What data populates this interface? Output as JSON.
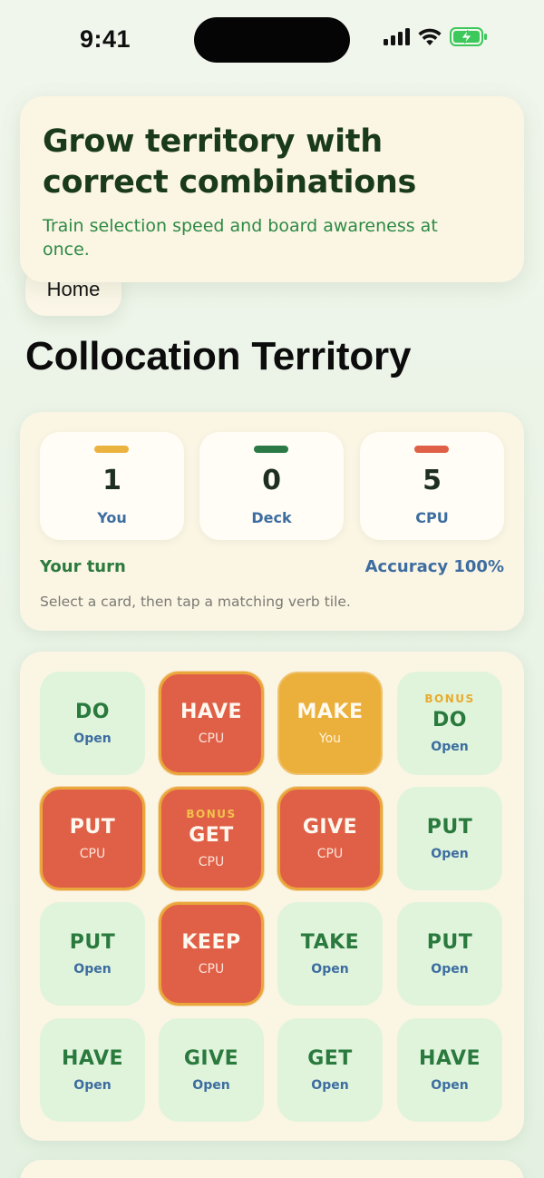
{
  "status_bar": {
    "time": "9:41",
    "icons": [
      "signal-icon",
      "wifi-icon",
      "battery-charging-icon"
    ],
    "battery_color": "#3cc85a"
  },
  "hero": {
    "title": "Grow territory with correct combinations",
    "subtitle": "Train selection speed and board awareness at once."
  },
  "nav": {
    "home_label": "Home"
  },
  "page": {
    "title": "Collocation Territory"
  },
  "scores": [
    {
      "value": "1",
      "label": "You",
      "bar_color": "#ebb240"
    },
    {
      "value": "0",
      "label": "Deck",
      "bar_color": "#2b7a45"
    },
    {
      "value": "5",
      "label": "CPU",
      "bar_color": "#e06047"
    }
  ],
  "status": {
    "turn": "Your turn",
    "accuracy": "Accuracy 100%",
    "hint": "Select a card, then tap a matching verb tile."
  },
  "colors": {
    "open_tile": "#e0f4dc",
    "cpu_tile": "#e06047",
    "you_tile": "#ebaf3c",
    "accent_green": "#2b7a3e",
    "accent_blue": "#3d6da0"
  },
  "board": {
    "tiles": [
      {
        "verb": "DO",
        "owner": "Open",
        "state": "open",
        "bonus": ""
      },
      {
        "verb": "HAVE",
        "owner": "CPU",
        "state": "cpu",
        "bonus": ""
      },
      {
        "verb": "MAKE",
        "owner": "You",
        "state": "you",
        "bonus": ""
      },
      {
        "verb": "DO",
        "owner": "Open",
        "state": "open",
        "bonus": "BONUS"
      },
      {
        "verb": "PUT",
        "owner": "CPU",
        "state": "cpu",
        "bonus": ""
      },
      {
        "verb": "GET",
        "owner": "CPU",
        "state": "cpu",
        "bonus": "BONUS"
      },
      {
        "verb": "GIVE",
        "owner": "CPU",
        "state": "cpu",
        "bonus": ""
      },
      {
        "verb": "PUT",
        "owner": "Open",
        "state": "open",
        "bonus": ""
      },
      {
        "verb": "PUT",
        "owner": "Open",
        "state": "open",
        "bonus": ""
      },
      {
        "verb": "KEEP",
        "owner": "CPU",
        "state": "cpu",
        "bonus": ""
      },
      {
        "verb": "TAKE",
        "owner": "Open",
        "state": "open",
        "bonus": ""
      },
      {
        "verb": "PUT",
        "owner": "Open",
        "state": "open",
        "bonus": ""
      },
      {
        "verb": "HAVE",
        "owner": "Open",
        "state": "open",
        "bonus": ""
      },
      {
        "verb": "GIVE",
        "owner": "Open",
        "state": "open",
        "bonus": ""
      },
      {
        "verb": "GET",
        "owner": "Open",
        "state": "open",
        "bonus": ""
      },
      {
        "verb": "HAVE",
        "owner": "Open",
        "state": "open",
        "bonus": ""
      }
    ]
  }
}
